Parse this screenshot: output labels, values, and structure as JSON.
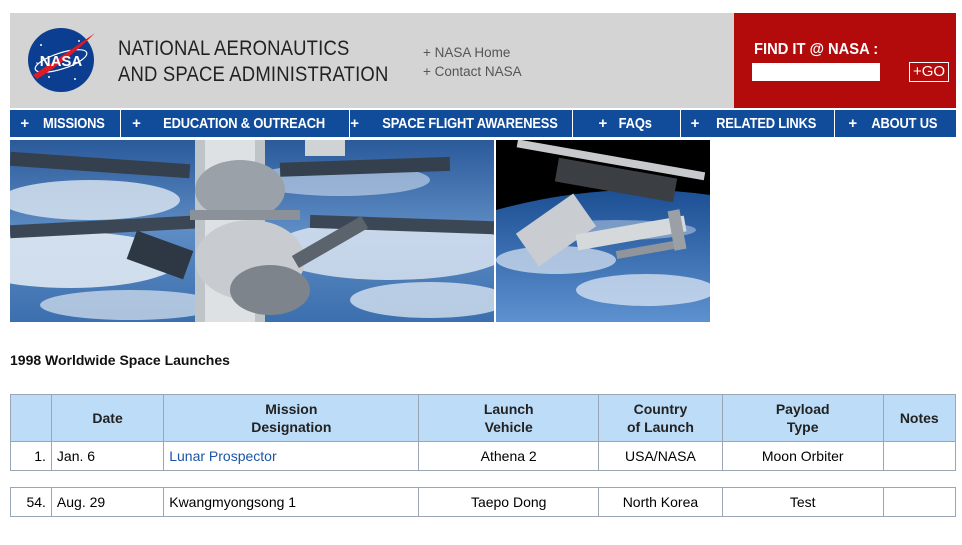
{
  "header": {
    "agency_line1": "NATIONAL AERONAUTICS",
    "agency_line2": "AND SPACE ADMINISTRATION",
    "logo_text": "NASA",
    "links": [
      "+ NASA Home",
      "+ Contact NASA"
    ],
    "find_label": "FIND IT @ NASA :",
    "find_value": "",
    "go_label": "+GO"
  },
  "nav": [
    {
      "plus": "+",
      "label": "MISSIONS"
    },
    {
      "plus": "+",
      "label": "EDUCATION & OUTREACH"
    },
    {
      "plus": "+",
      "label": "SPACE FLIGHT AWARENESS"
    },
    {
      "plus": "+",
      "label": "FAQs"
    },
    {
      "plus": "+",
      "label": "RELATED LINKS"
    },
    {
      "plus": "+",
      "label": "ABOUT US"
    }
  ],
  "heading": "1998 Worldwide Space Launches",
  "table": {
    "columns": [
      {
        "line1": "",
        "line2": ""
      },
      {
        "line1": "Date",
        "line2": ""
      },
      {
        "line1": "Mission",
        "line2": "Designation"
      },
      {
        "line1": "Launch",
        "line2": "Vehicle"
      },
      {
        "line1": "Country",
        "line2": "of Launch"
      },
      {
        "line1": "Payload",
        "line2": "Type"
      },
      {
        "line1": "Notes",
        "line2": ""
      }
    ],
    "rows": [
      {
        "num": "1.",
        "date": "Jan. 6",
        "mission": "Lunar Prospector",
        "vehicle": "Athena 2",
        "country": "USA/NASA",
        "payload": "Moon Orbiter",
        "notes": ""
      },
      {
        "num": "54.",
        "date": "Aug. 29",
        "mission": "Kwangmyongsong 1",
        "vehicle": "Taepo Dong",
        "country": "North Korea",
        "payload": "Test",
        "notes": ""
      }
    ]
  },
  "colors": {
    "header_bg": "#d4d4d4",
    "find_bg": "#b30b0b",
    "nav_bg": "#114c9a",
    "table_header_bg": "#bcdcf8",
    "link": "#1b55a8"
  }
}
